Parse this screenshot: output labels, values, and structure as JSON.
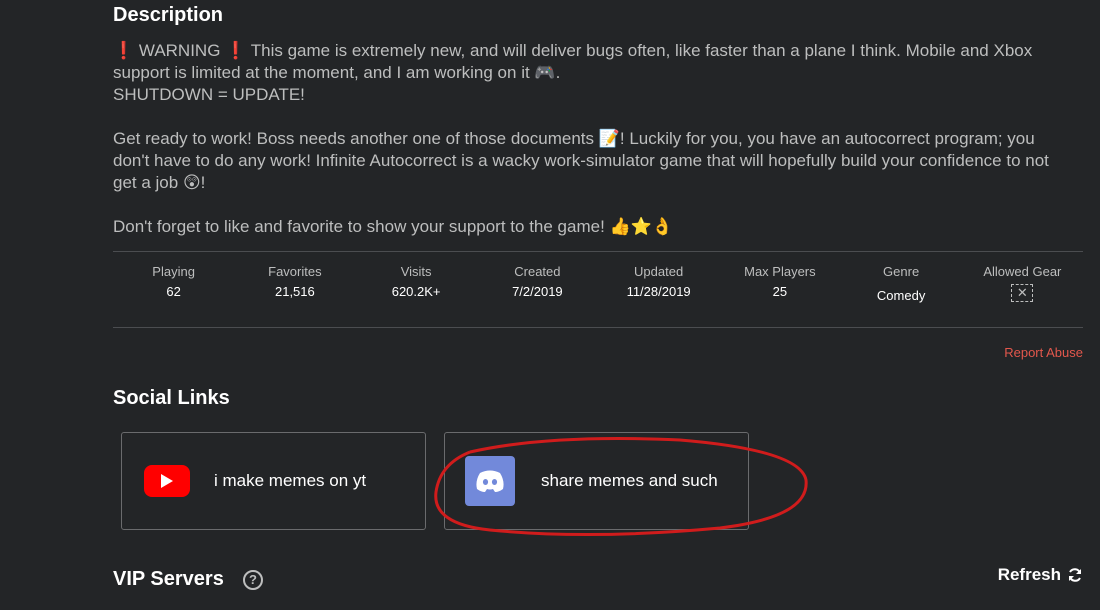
{
  "description": {
    "title": "Description",
    "warning_prefix": "❗",
    "warning_word": "WARNING",
    "warning_suffix": "❗",
    "line1": " This game is extremely new, and will deliver bugs often, like faster than a plane I think. Mobile and Xbox support is limited at the moment, and I am working on it 🎮.",
    "line2": "SHUTDOWN = UPDATE!",
    "para2": "Get ready to work! Boss needs another one of those documents 📝! Luckily for you, you have an autocorrect program; you don't have to do any work! Infinite Autocorrect is a wacky work-simulator game that will hopefully build your confidence to not get a job 😲!",
    "para3": "Don't forget to like and favorite to show your support to the game! 👍⭐👌"
  },
  "stats": {
    "playing": {
      "label": "Playing",
      "value": "62"
    },
    "favorites": {
      "label": "Favorites",
      "value": "21,516"
    },
    "visits": {
      "label": "Visits",
      "value": "620.2K+"
    },
    "created": {
      "label": "Created",
      "value": "7/2/2019"
    },
    "updated": {
      "label": "Updated",
      "value": "11/28/2019"
    },
    "max_players": {
      "label": "Max Players",
      "value": "25"
    },
    "genre": {
      "label": "Genre",
      "value": "Comedy"
    },
    "allowed_gear": {
      "label": "Allowed Gear",
      "icon": "no-gear-icon"
    }
  },
  "report_abuse": "Report Abuse",
  "social": {
    "title": "Social Links",
    "links": [
      {
        "label": "i make memes on yt",
        "icon": "youtube-icon"
      },
      {
        "label": "share memes and such",
        "icon": "discord-icon"
      }
    ]
  },
  "vip": {
    "title": "VIP Servers",
    "refresh_label": "Refresh"
  },
  "colors": {
    "background": "#232527",
    "text": "#bdbebe",
    "accent_red": "#e2574c",
    "annotation": "#d01c1c",
    "discord": "#7289da",
    "youtube": "#ff0000"
  }
}
